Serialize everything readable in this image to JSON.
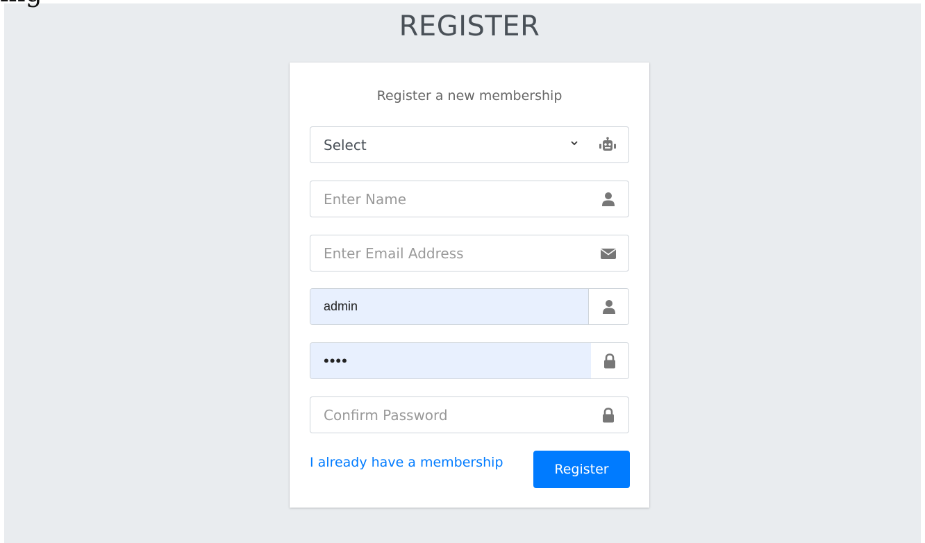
{
  "header": {
    "cut_heading": "ing",
    "title": "REGISTER"
  },
  "card": {
    "subtitle": "Register a new membership",
    "role_select": {
      "value": "Select",
      "icon": "robot-icon"
    },
    "name_input": {
      "placeholder": "Enter Name",
      "icon": "user-icon"
    },
    "email_input": {
      "placeholder": "Enter Email Address",
      "icon": "envelope-icon"
    },
    "username_input": {
      "value": "admin",
      "icon": "user-icon"
    },
    "password_input": {
      "value": "••••",
      "icon": "lock-icon"
    },
    "confirm_password_input": {
      "placeholder": "Confirm Password",
      "icon": "lock-icon"
    },
    "login_link": "I already have a membership",
    "register_button": "Register"
  },
  "colors": {
    "background": "#e9ecef",
    "accent": "#007bff",
    "autofill": "#e8f0fe",
    "icon": "#777777"
  }
}
